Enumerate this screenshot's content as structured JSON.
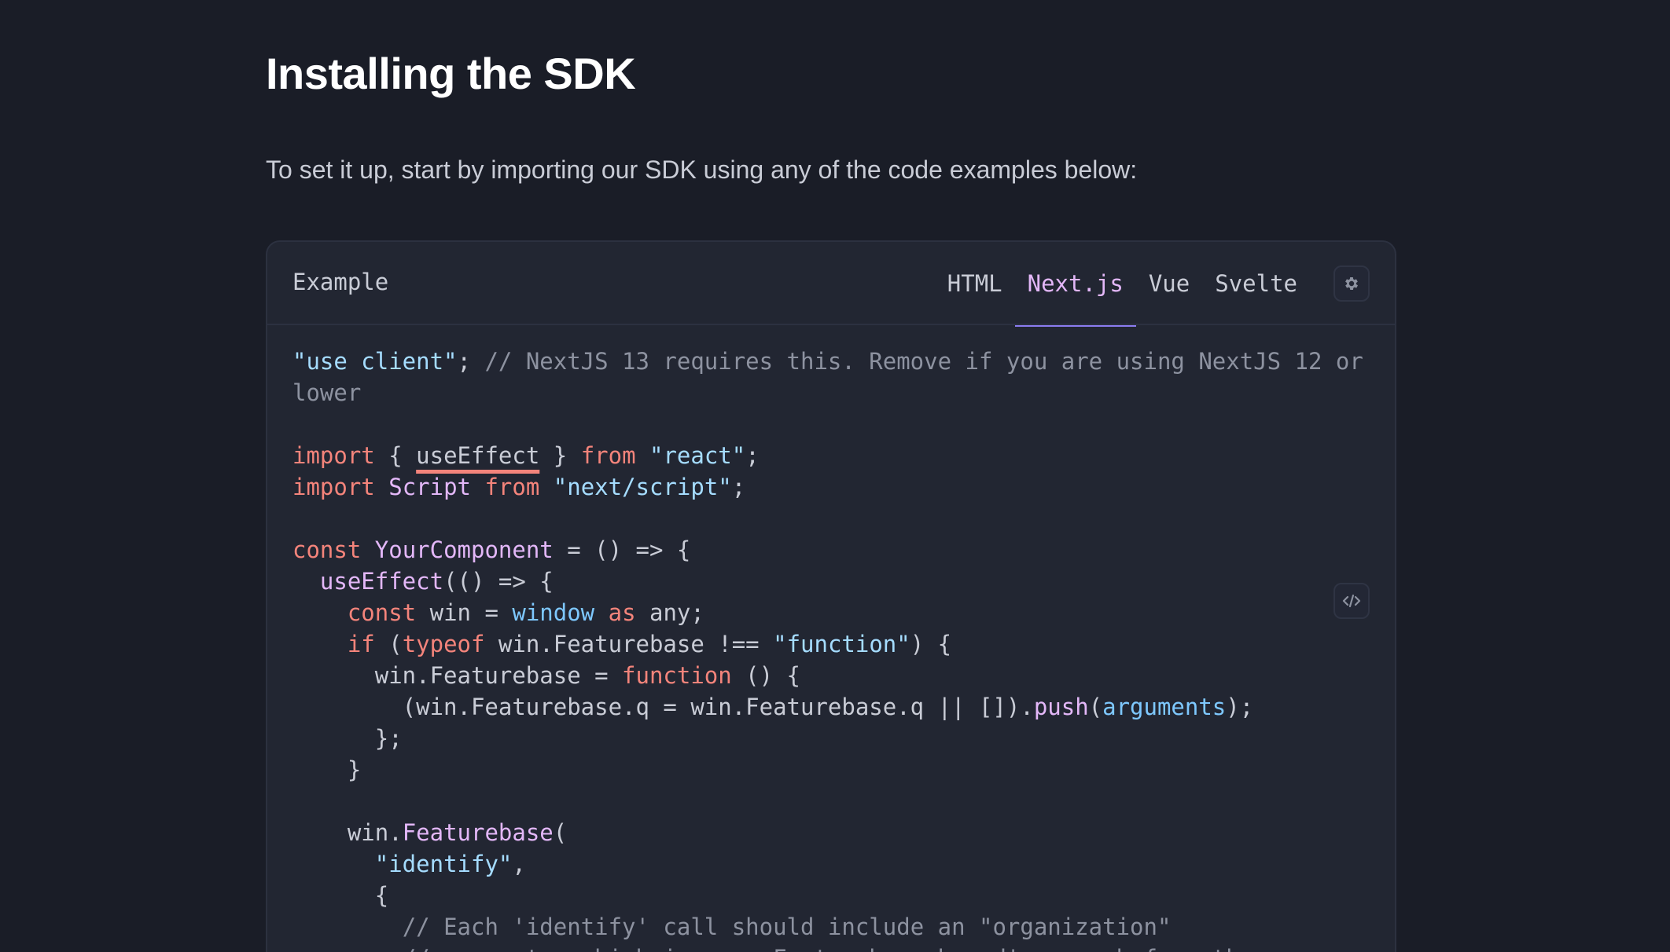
{
  "page": {
    "title": "Installing the SDK",
    "intro": "To set it up, start by importing our SDK using any of the code examples below:"
  },
  "code_panel": {
    "title": "Example",
    "tabs": [
      {
        "label": "HTML",
        "active": false
      },
      {
        "label": "Next.js",
        "active": true
      },
      {
        "label": "Vue",
        "active": false
      },
      {
        "label": "Svelte",
        "active": false
      }
    ],
    "settings_icon": "gear-icon",
    "view_code_icon": "code-icon",
    "code": {
      "l1": {
        "a": "\"use client\"",
        "b": "; ",
        "c": "// NextJS 13 requires this. Remove if you are using NextJS 12 or"
      },
      "l2": {
        "a": "lower"
      },
      "l4": {
        "a": "import",
        "b": " { ",
        "c": "useEffect",
        "d": " } ",
        "e": "from",
        "f": " ",
        "g": "\"react\"",
        "h": ";"
      },
      "l5": {
        "a": "import",
        "b": " ",
        "c": "Script",
        "d": " ",
        "e": "from",
        "f": " ",
        "g": "\"next/script\"",
        "h": ";"
      },
      "l7": {
        "a": "const",
        "b": " ",
        "c": "YourComponent",
        "d": " = () => {"
      },
      "l8": {
        "a": "  ",
        "b": "useEffect",
        "c": "(() => {"
      },
      "l9": {
        "a": "    ",
        "b": "const",
        "c": " win = ",
        "d": "window",
        "e": " ",
        "f": "as",
        "g": " any;"
      },
      "l10": {
        "a": "    ",
        "b": "if",
        "c": " (",
        "d": "typeof",
        "e": " win.Featurebase !== ",
        "f": "\"function\"",
        "g": ") {"
      },
      "l11": {
        "a": "      win.Featurebase = ",
        "b": "function",
        "c": " () {"
      },
      "l12": {
        "a": "        (win.Featurebase.q = win.Featurebase.q || []).",
        "b": "push",
        "c": "(",
        "d": "arguments",
        "e": ");"
      },
      "l13": {
        "a": "      };"
      },
      "l14": {
        "a": "    }"
      },
      "l16": {
        "a": "    win.",
        "b": "Featurebase",
        "c": "("
      },
      "l17": {
        "a": "      ",
        "b": "\"identify\"",
        "c": ","
      },
      "l18": {
        "a": "      {"
      },
      "l19": {
        "a": "        ",
        "b": "// Each 'identify' call should include an \"organization\""
      },
      "l20": {
        "a": "        ",
        "b": "// property, which is your Featurebase board's name before the"
      }
    }
  },
  "colors": {
    "background": "#1a1d27",
    "panel": "#222632",
    "keyword": "#f4847b",
    "string": "#a5dcff",
    "function": "#e3b7f8",
    "comment": "#8d92a0",
    "active_tab": "#e3b7f8",
    "tab_underline": "#8b7cf0"
  }
}
